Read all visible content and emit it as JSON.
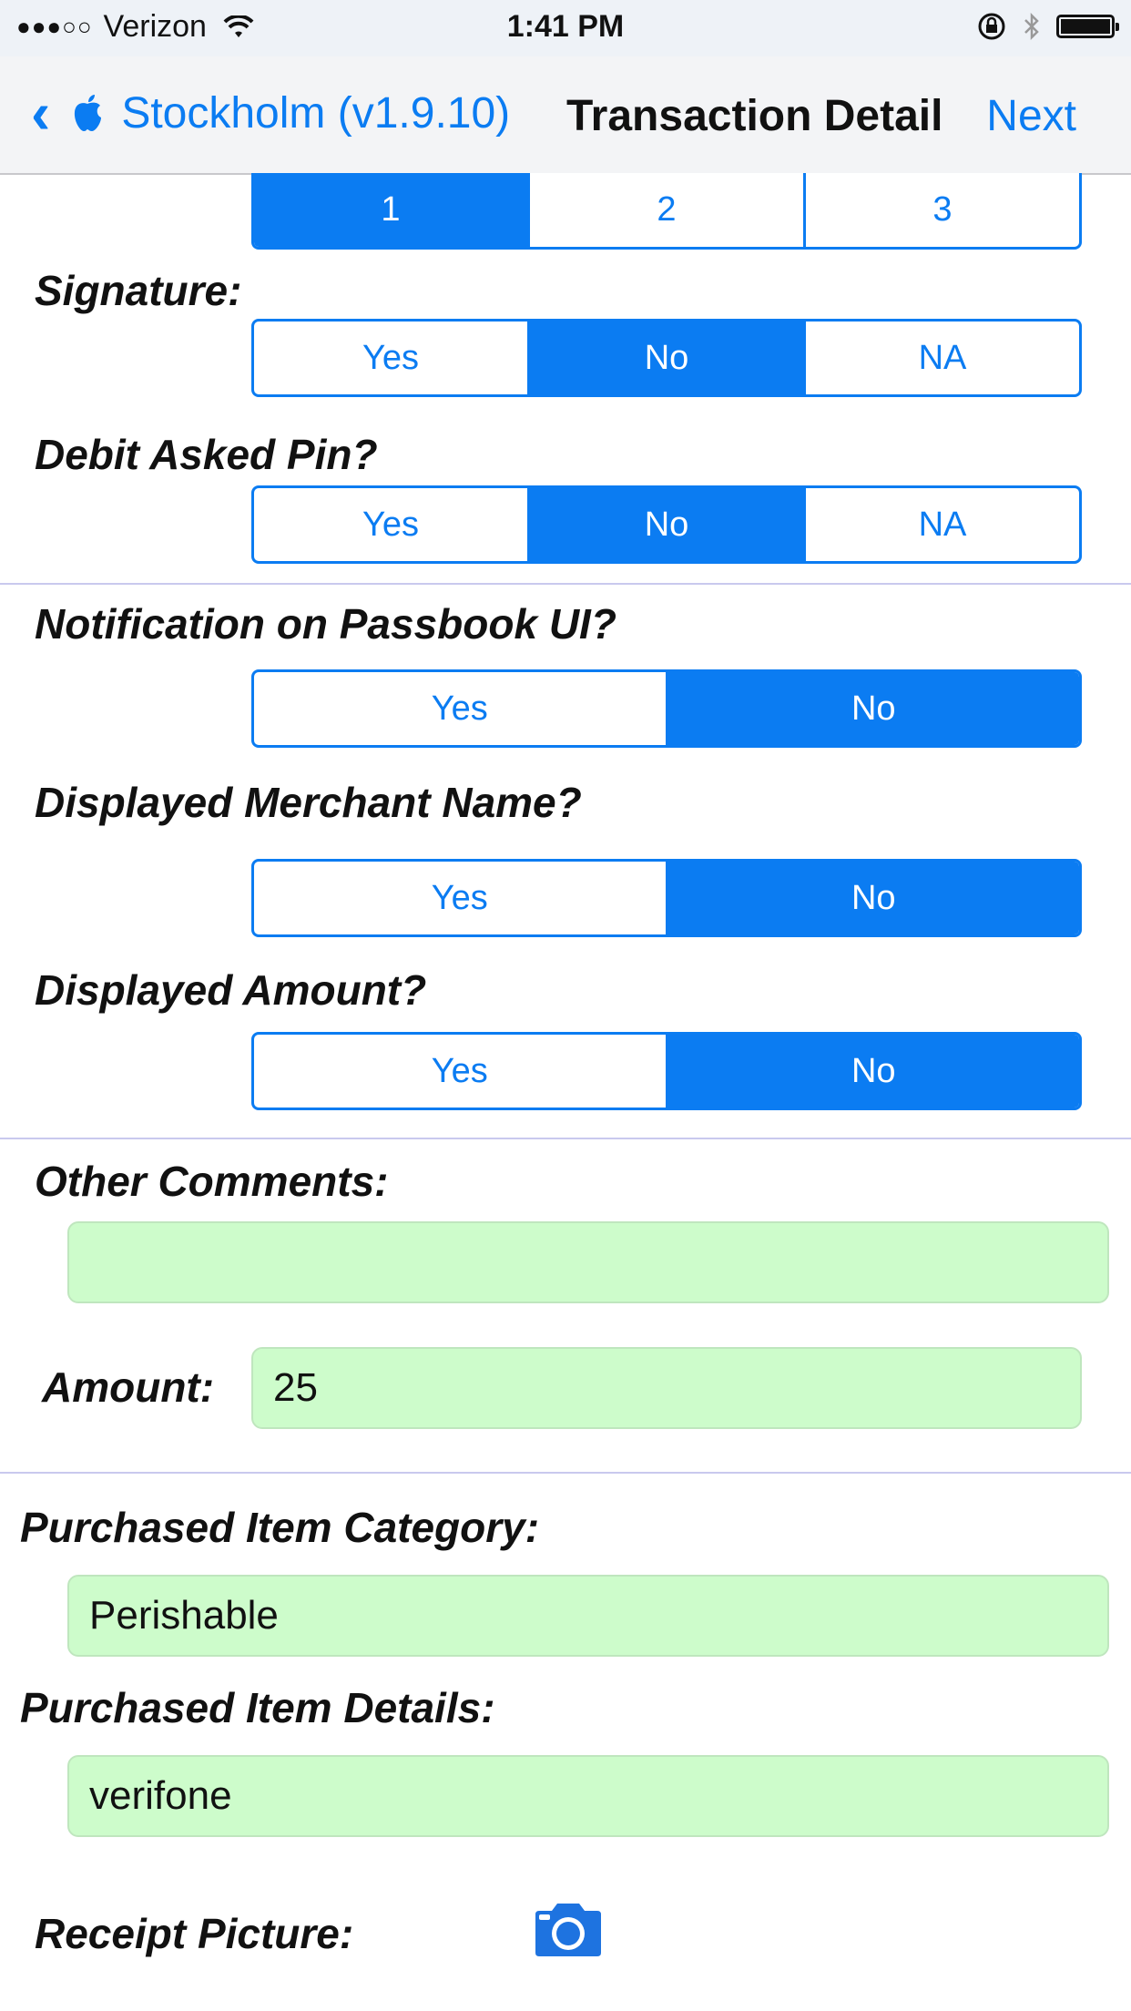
{
  "status_bar": {
    "signal": "●●●○○",
    "carrier": "Verizon",
    "time": "1:41 PM"
  },
  "nav": {
    "back_label": "Stockholm (v1.9.10)",
    "title": "Transaction Detail",
    "next_label": "Next"
  },
  "top_segment": {
    "options": [
      "1",
      "2",
      "3"
    ],
    "selected": "1"
  },
  "signature": {
    "label": "Signature:",
    "options": [
      "Yes",
      "No",
      "NA"
    ],
    "selected": "No"
  },
  "debit_pin": {
    "label": "Debit Asked Pin?",
    "options": [
      "Yes",
      "No",
      "NA"
    ],
    "selected": "No"
  },
  "passbook": {
    "label": "Notification on Passbook UI?",
    "options": [
      "Yes",
      "No"
    ],
    "selected": "No"
  },
  "merchant_name": {
    "label": "Displayed Merchant Name?",
    "options": [
      "Yes",
      "No"
    ],
    "selected": "No"
  },
  "amount_displayed": {
    "label": "Displayed Amount?",
    "options": [
      "Yes",
      "No"
    ],
    "selected": "No"
  },
  "comments": {
    "label": "Other Comments:",
    "value": ""
  },
  "amount": {
    "label": "Amount:",
    "value": "25"
  },
  "category": {
    "label": "Purchased Item Category:",
    "value": "Perishable"
  },
  "details": {
    "label": "Purchased Item Details:",
    "value": "verifone"
  },
  "receipt": {
    "label": "Receipt Picture:",
    "icon": "camera-icon"
  },
  "colors": {
    "accent": "#0b7cf2",
    "field_bg": "#cdfccb"
  }
}
